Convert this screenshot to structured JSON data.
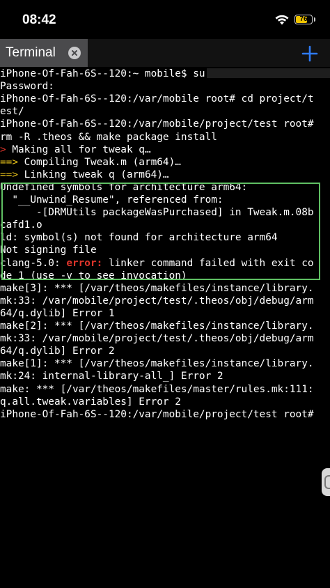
{
  "status_bar": {
    "time": "08:42",
    "battery_level": "76",
    "battery_color": "#f0c400"
  },
  "tabs": [
    {
      "label": "Terminal",
      "close_icon": "close-circle-icon"
    }
  ],
  "add_tab_icon": "plus-icon",
  "terminal": {
    "lines": [
      {
        "prefix": "",
        "text": "iPhone-Of-Fah-6S--120:~ mobile$ su"
      },
      {
        "prefix": "",
        "text": "Password:"
      },
      {
        "prefix": "",
        "text": "iPhone-Of-Fah-6S--120:/var/mobile root# cd project/t"
      },
      {
        "prefix": "",
        "text": "est/"
      },
      {
        "prefix": "",
        "text": "iPhone-Of-Fah-6S--120:/var/mobile/project/test root#"
      },
      {
        "prefix": "",
        "text": "rm -R .theos && make package install"
      },
      {
        "prefix": ">",
        "text": " Making all for tweak q…"
      },
      {
        "prefix": "==>",
        "text": " Compiling Tweak.m (arm64)…"
      },
      {
        "prefix": "==>",
        "text": " Linking tweak q (arm64)…"
      },
      {
        "prefix": "",
        "text": "Undefined symbols for architecture arm64:"
      },
      {
        "prefix": "",
        "text": "  \"__Unwind_Resume\", referenced from:"
      },
      {
        "prefix": "",
        "text": "      -[DRMUtils packageWasPurchased] in Tweak.m.08b"
      },
      {
        "prefix": "",
        "text": "cafd1.o"
      },
      {
        "prefix": "",
        "text": "ld: symbol(s) not found for architecture arm64"
      },
      {
        "prefix": "",
        "text": "Not signing file"
      },
      {
        "prefix": "",
        "text": "clang-5.0: ",
        "error": "error:",
        "suffix": " linker command failed with exit co"
      },
      {
        "prefix": "",
        "text": "de 1 (use -v to see invocation)"
      },
      {
        "prefix": "",
        "text": "make[3]: *** [/var/theos/makefiles/instance/library."
      },
      {
        "prefix": "",
        "text": "mk:33: /var/mobile/project/test/.theos/obj/debug/arm"
      },
      {
        "prefix": "",
        "text": "64/q.dylib] Error 1"
      },
      {
        "prefix": "",
        "text": "make[2]: *** [/var/theos/makefiles/instance/library."
      },
      {
        "prefix": "",
        "text": "mk:33: /var/mobile/project/test/.theos/obj/debug/arm"
      },
      {
        "prefix": "",
        "text": "64/q.dylib] Error 2"
      },
      {
        "prefix": "",
        "text": "make[1]: *** [/var/theos/makefiles/instance/library."
      },
      {
        "prefix": "",
        "text": "mk:24: internal-library-all_] Error 2"
      },
      {
        "prefix": "",
        "text": "make: *** [/var/theos/makefiles/master/rules.mk:111:"
      },
      {
        "prefix": "",
        "text": "q.all.tweak.variables] Error 2"
      },
      {
        "prefix": "",
        "text": "iPhone-Of-Fah-6S--120:/var/mobile/project/test root#"
      }
    ],
    "prefix_colors": {
      ">": "#e0352b",
      "==>": "#e8c21a"
    },
    "highlight_color": "#5fbf63"
  }
}
